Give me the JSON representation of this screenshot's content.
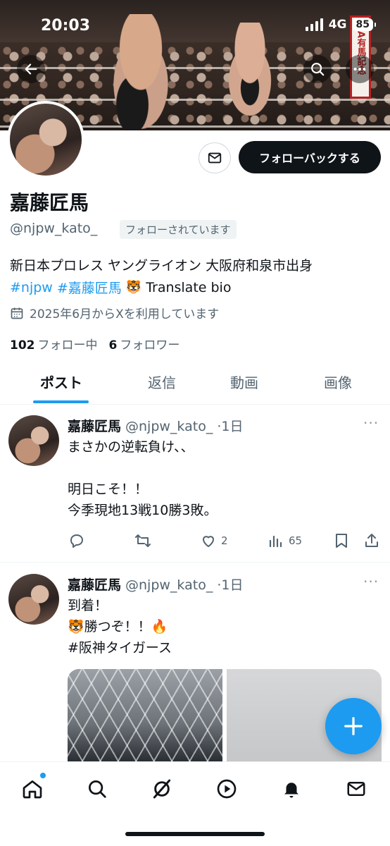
{
  "status_bar": {
    "time": "20:03",
    "network": "4G",
    "battery": "85"
  },
  "banner": {
    "sign_text": "JRA有馬記念"
  },
  "profile": {
    "display_name": "嘉藤匠馬",
    "handle": "@njpw_kato_",
    "follows_you": "フォローされています",
    "follow_back_label": "フォローバックする",
    "bio_line1": "新日本プロレス ヤングライオン 大阪府和泉市出身",
    "bio_tag1": "#njpw",
    "bio_tag2": "#嘉藤匠馬",
    "bio_emoji": "🐯",
    "translate_label": "Translate bio",
    "joined": "2025年6月からXを利用しています",
    "following_count": "102",
    "following_label": "フォロー中",
    "followers_count": "6",
    "followers_label": "フォロワー"
  },
  "tabs": [
    {
      "label": "ポスト",
      "active": true
    },
    {
      "label": "返信",
      "active": false
    },
    {
      "label": "動画",
      "active": false
    },
    {
      "label": "画像",
      "active": false
    }
  ],
  "posts": [
    {
      "name": "嘉藤匠馬",
      "handle": "@njpw_kato_",
      "time": "·1日",
      "text": "まさかの逆転負け、、\n\n明日こそ！！\n今季現地13戦10勝3敗。",
      "likes": "2",
      "views": "65"
    },
    {
      "name": "嘉藤匠馬",
      "handle": "@njpw_kato_",
      "time": "·1日",
      "line1": "到着！",
      "line2": "🐯勝つぞ！！🔥",
      "hashtag": "#阪神タイガース"
    }
  ],
  "colors": {
    "accent": "#1d9bf0",
    "text": "#0f1419",
    "muted": "#536471"
  }
}
